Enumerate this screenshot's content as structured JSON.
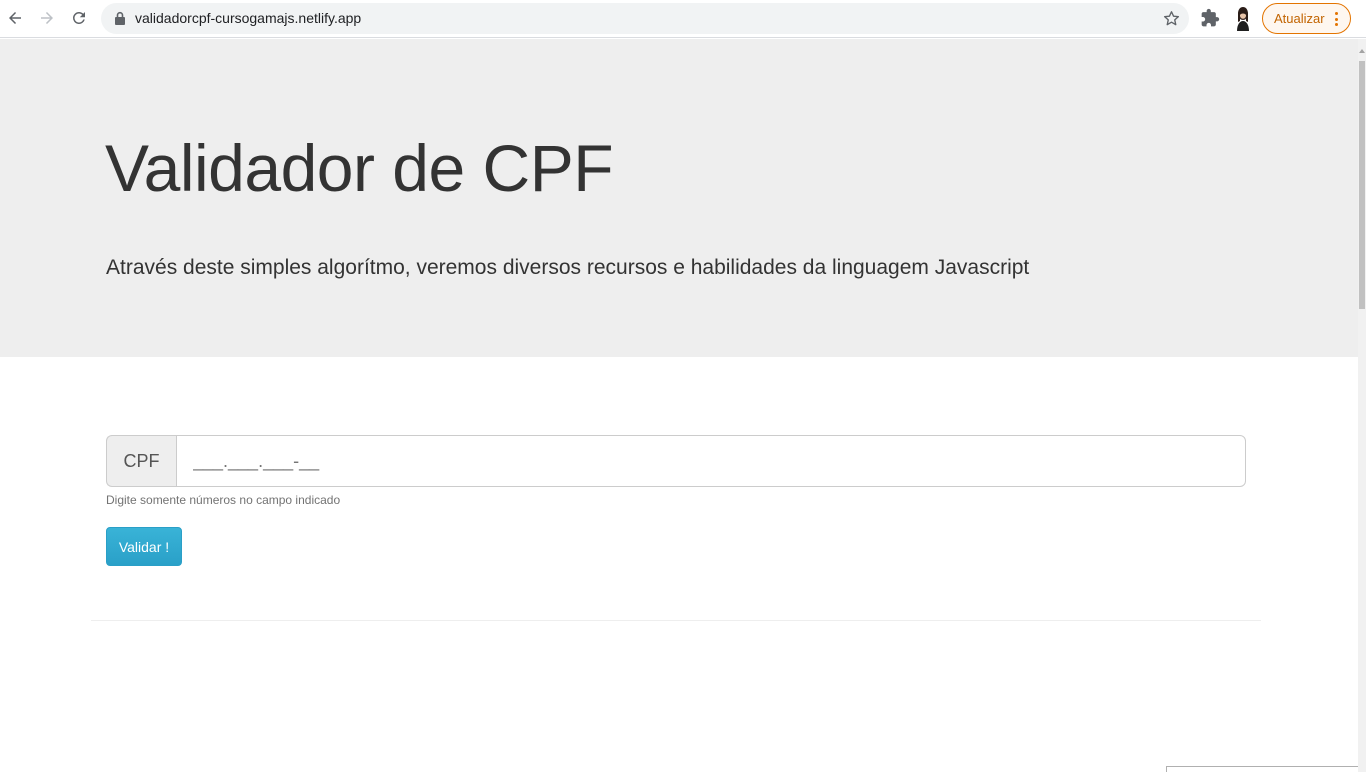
{
  "browser": {
    "url": "validadorcpf-cursogamajs.netlify.app",
    "update_button_label": "Atualizar",
    "accent_color": "#e37400"
  },
  "page": {
    "title": "Validador de CPF",
    "lead": "Através deste simples algorítmo, veremos diversos recursos e habilidades da linguagem Javascript",
    "cpf_addon": "CPF",
    "cpf_placeholder": "___.___.___-__",
    "cpf_value": "",
    "help_text": "Digite somente números no campo indicado",
    "validate_button_label": "Validar !",
    "jumbotron_color": "#eeeeee",
    "button_color": "#2aa0c8"
  }
}
